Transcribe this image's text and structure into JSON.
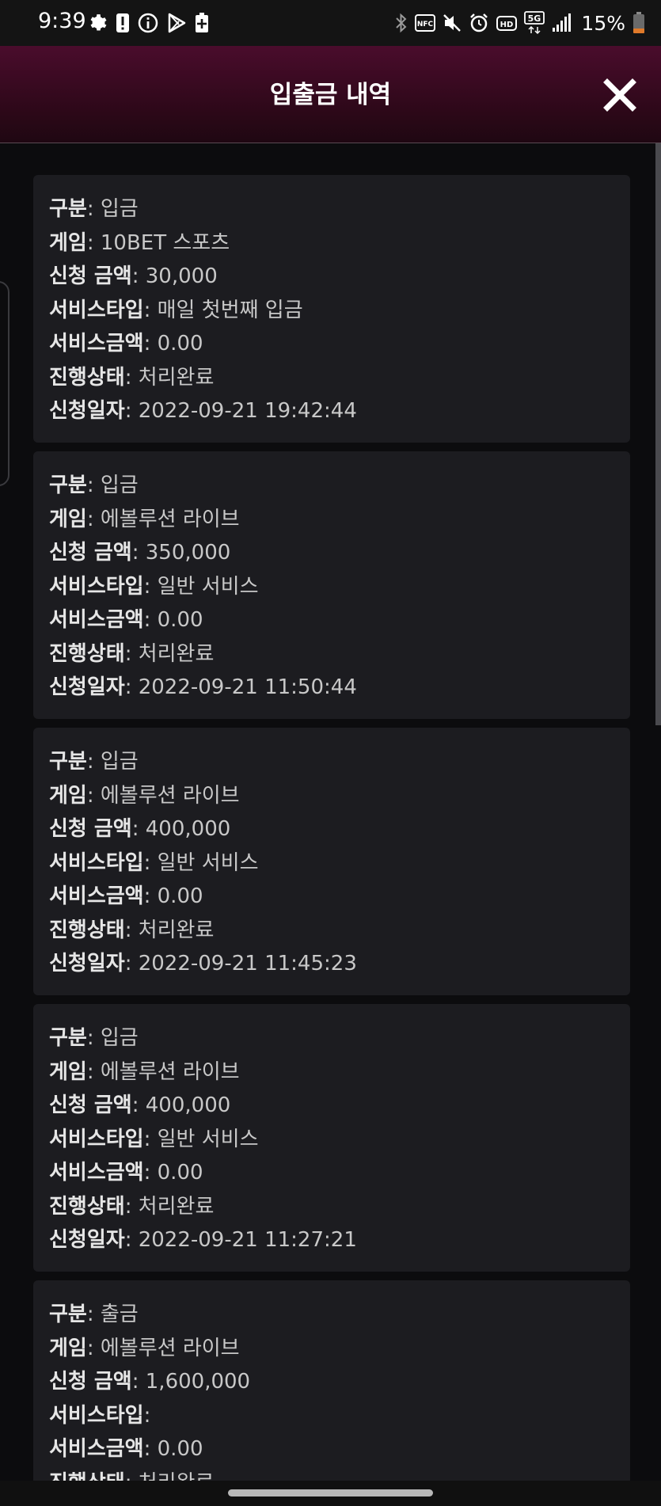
{
  "status_bar": {
    "time": "9:39",
    "left_icons": [
      "gear-icon",
      "alert-icon",
      "info-icon",
      "play-store-icon",
      "battery-saver-icon"
    ],
    "right_icons": [
      "bluetooth-icon",
      "nfc-icon",
      "mute-icon",
      "alarm-icon",
      "hd-icon",
      "5g-icon",
      "signal-icon"
    ],
    "battery_percent": "15%"
  },
  "header": {
    "title": "입출금 내역",
    "close_icon": "close-icon"
  },
  "labels": {
    "type": "구분",
    "game": "게임",
    "amount": "신청 금액",
    "service_type": "서비스타입",
    "service_amount": "서비스금액",
    "status": "진행상태",
    "date": "신청일자",
    "separator": ": "
  },
  "transactions": [
    {
      "type": "입금",
      "game": "10BET 스포츠",
      "amount": "30,000",
      "service_type": "매일 첫번째 입금",
      "service_amount": "0.00",
      "status": "처리완료",
      "date": "2022-09-21 19:42:44"
    },
    {
      "type": "입금",
      "game": "에볼루션 라이브",
      "amount": "350,000",
      "service_type": "일반 서비스",
      "service_amount": "0.00",
      "status": "처리완료",
      "date": "2022-09-21 11:50:44"
    },
    {
      "type": "입금",
      "game": "에볼루션 라이브",
      "amount": "400,000",
      "service_type": "일반 서비스",
      "service_amount": "0.00",
      "status": "처리완료",
      "date": "2022-09-21 11:45:23"
    },
    {
      "type": "입금",
      "game": "에볼루션 라이브",
      "amount": "400,000",
      "service_type": "일반 서비스",
      "service_amount": "0.00",
      "status": "처리완료",
      "date": "2022-09-21 11:27:21"
    },
    {
      "type": "출금",
      "game": "에볼루션 라이브",
      "amount": "1,600,000",
      "service_type": "",
      "service_amount": "0.00",
      "status": "처리완료",
      "date": ""
    }
  ],
  "colors": {
    "header_gradient_top": "#4a0c2c",
    "header_gradient_bottom": "#1f0712",
    "card_background": "#1c1c20",
    "page_background": "#0c0c0e"
  }
}
